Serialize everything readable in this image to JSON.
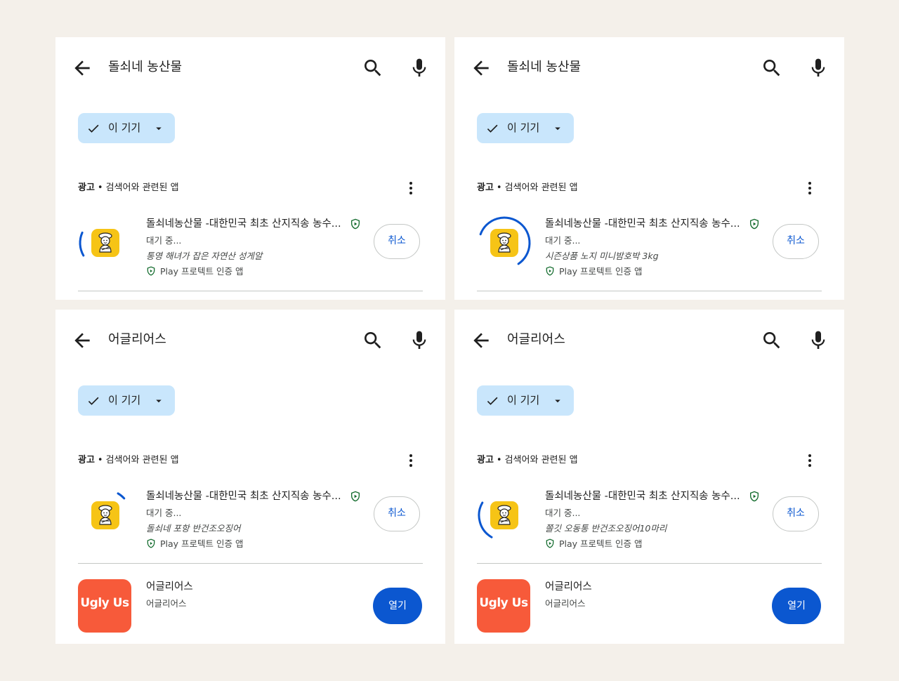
{
  "colors": {
    "background": "#f4f0ea",
    "chip": "#c9e6fc",
    "accent_blue": "#0b57d0",
    "protect_green": "#146c2e",
    "app_icon_yellow": "#f6c416",
    "uglyus_orange": "#f75a3a"
  },
  "panels": [
    {
      "search_query": "돌쇠네 농산물",
      "filter_chip": "이 기기",
      "section": {
        "ad_label": "광고",
        "separator": "•",
        "title": "검색어와 관련된 앱"
      },
      "app": {
        "title": "돌쇠네농산물 -대한민국 최초 산지직송 농수...",
        "status": "대기 중...",
        "promo": "통영 해녀가 잡은 자연산 성게알",
        "protect": "Play 프로텍트 인증 앱",
        "action": "취소",
        "download_progress": 0.15
      }
    },
    {
      "search_query": "돌쇠네 농산물",
      "filter_chip": "이 기기",
      "section": {
        "ad_label": "광고",
        "separator": "•",
        "title": "검색어와 관련된 앱"
      },
      "app": {
        "title": "돌쇠네농산물 -대한민국 최초 산지직송 농수...",
        "status": "대기 중...",
        "promo": "시즌상품 노지 미니밤호박 3kg",
        "protect": "Play 프로텍트 인증 앱",
        "action": "취소",
        "download_progress": 0.6
      }
    },
    {
      "search_query": "어글리어스",
      "filter_chip": "이 기기",
      "section": {
        "ad_label": "광고",
        "separator": "•",
        "title": "검색어와 관련된 앱"
      },
      "app": {
        "title": "돌쇠네농산물 -대한민국 최초 산지직송 농수...",
        "status": "대기 중...",
        "promo": "돌쇠네 포항 반건조오징어",
        "protect": "Play 프로텍트 인증 앱",
        "action": "취소",
        "download_progress": 0.05
      },
      "second_app": {
        "name": "어글리어스",
        "developer": "어글리어스",
        "logo_text": "Ugly Us",
        "action": "열기"
      }
    },
    {
      "search_query": "어글리어스",
      "filter_chip": "이 기기",
      "section": {
        "ad_label": "광고",
        "separator": "•",
        "title": "검색어와 관련된 앱"
      },
      "app": {
        "title": "돌쇠네농산물 -대한민국 최초 산지직송 농수...",
        "status": "대기 중...",
        "promo": "쫄깃 오동통 반건조오징어10마리",
        "protect": "Play 프로텍트 인증 앱",
        "action": "취소",
        "download_progress": 0.25
      },
      "second_app": {
        "name": "어글리어스",
        "developer": "어글리어스",
        "logo_text": "Ugly Us",
        "action": "열기"
      }
    }
  ]
}
